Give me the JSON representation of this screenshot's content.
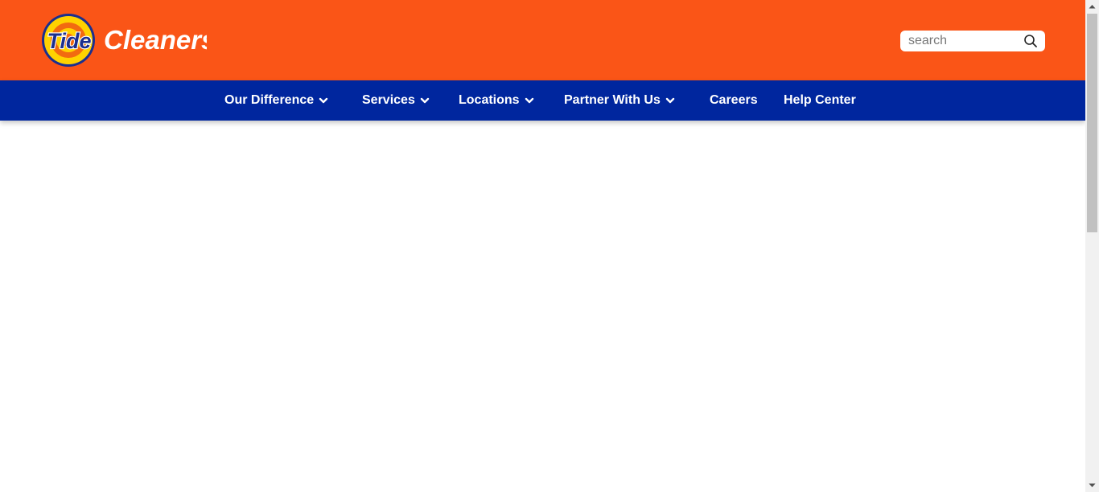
{
  "brand": {
    "badge_text": "Tide",
    "wordmark": "Cleaners",
    "colors": {
      "header_orange": "#fa5517",
      "nav_blue": "#00269e",
      "badge_yellow": "#ffd200",
      "badge_orange": "#f26a10",
      "badge_blue": "#1b2f8f"
    }
  },
  "search": {
    "placeholder": "search",
    "icon": "search-icon"
  },
  "nav": {
    "items": [
      {
        "label": "Our Difference",
        "has_dropdown": true,
        "icon": "chevron-down-icon"
      },
      {
        "label": "Services",
        "has_dropdown": true,
        "icon": "chevron-down-icon"
      },
      {
        "label": "Locations",
        "has_dropdown": true,
        "icon": "chevron-down-icon"
      },
      {
        "label": "Partner With Us",
        "has_dropdown": true,
        "icon": "chevron-down-icon"
      },
      {
        "label": "Careers",
        "has_dropdown": false
      },
      {
        "label": "Help Center",
        "has_dropdown": false
      }
    ]
  },
  "scrollbar": {
    "up_icon": "scroll-up-arrow-icon",
    "down_icon": "scroll-down-arrow-icon"
  }
}
